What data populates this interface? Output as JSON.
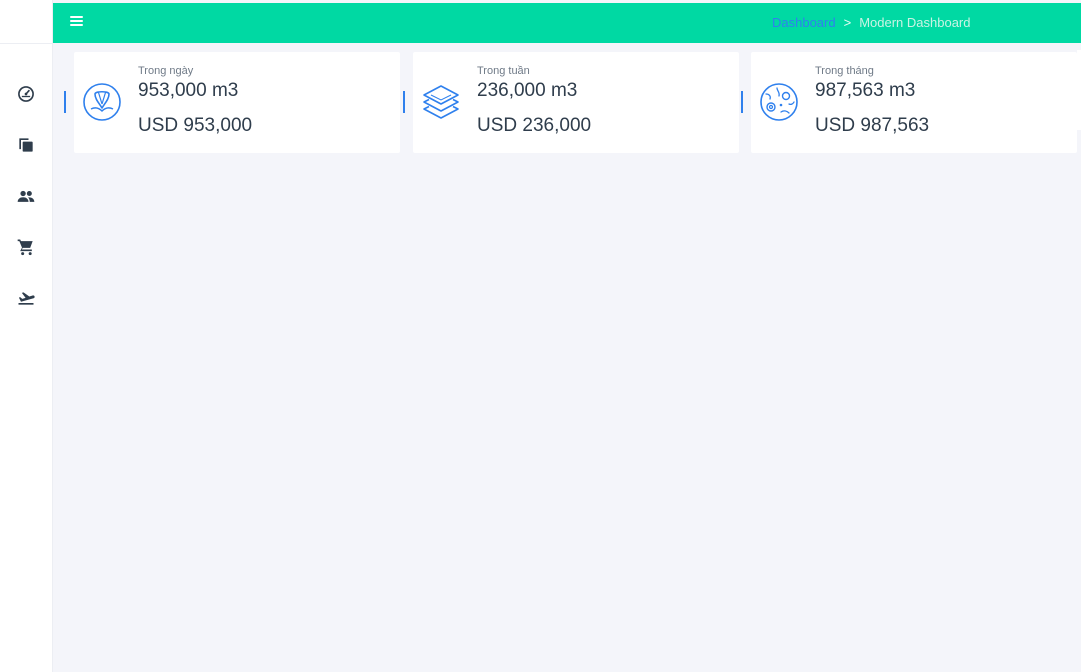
{
  "colors": {
    "topbar": "#00d9a3",
    "accent": "#2f80ed",
    "text": "#2f3d4c",
    "background": "#f4f5fa"
  },
  "sidebar": {
    "items": [
      {
        "icon": "dashboard-gauge-icon"
      },
      {
        "icon": "copy-pages-icon"
      },
      {
        "icon": "users-icon"
      },
      {
        "icon": "shopping-cart-icon"
      },
      {
        "icon": "flight-takeoff-icon"
      }
    ]
  },
  "topbar": {
    "menu_icon": "hamburger-icon"
  },
  "breadcrumb": {
    "link": "Dashboard",
    "separator": ">",
    "current": "Modern Dashboard"
  },
  "cards": [
    {
      "icon": "map-pin-icon",
      "label": "Trong ngày",
      "volume": "953,000 m3",
      "money": "USD 953,000"
    },
    {
      "icon": "layers-icon",
      "label": "Trong tuần",
      "volume": "236,000 m3",
      "money": "USD 236,000"
    },
    {
      "icon": "globe-icon",
      "label": "Trong tháng",
      "volume": "987,563 m3",
      "money": "USD 987,563"
    }
  ]
}
